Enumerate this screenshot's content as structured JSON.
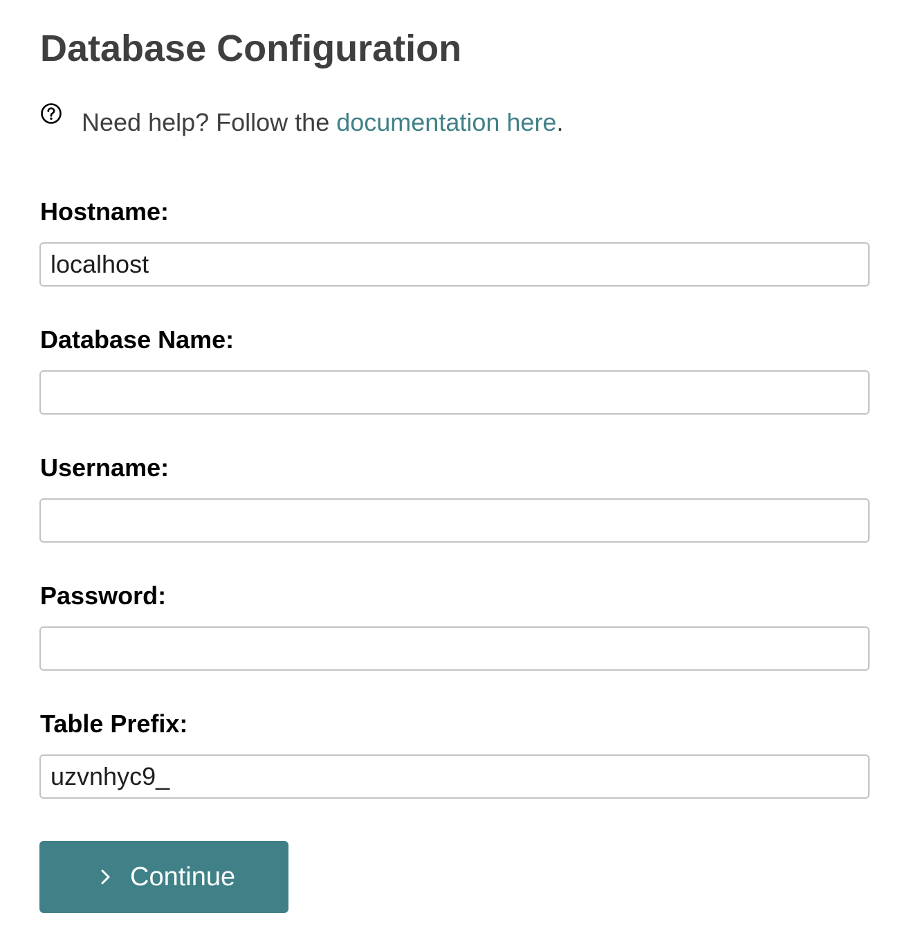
{
  "page": {
    "title": "Database Configuration"
  },
  "help": {
    "icon": "question-circle-icon",
    "text_before": "Need help? Follow the ",
    "link_text": "documentation here",
    "text_after": ".",
    "link_color": "#3f8186"
  },
  "form": {
    "hostname": {
      "label": "Hostname:",
      "value": "localhost"
    },
    "database_name": {
      "label": "Database Name:",
      "value": ""
    },
    "username": {
      "label": "Username:",
      "value": ""
    },
    "password": {
      "label": "Password:",
      "value": ""
    },
    "table_prefix": {
      "label": "Table Prefix:",
      "value": "uzvnhyc9_"
    }
  },
  "continue_button": {
    "icon": "chevron-right-icon",
    "label": "Continue",
    "color": "#3f8186"
  }
}
